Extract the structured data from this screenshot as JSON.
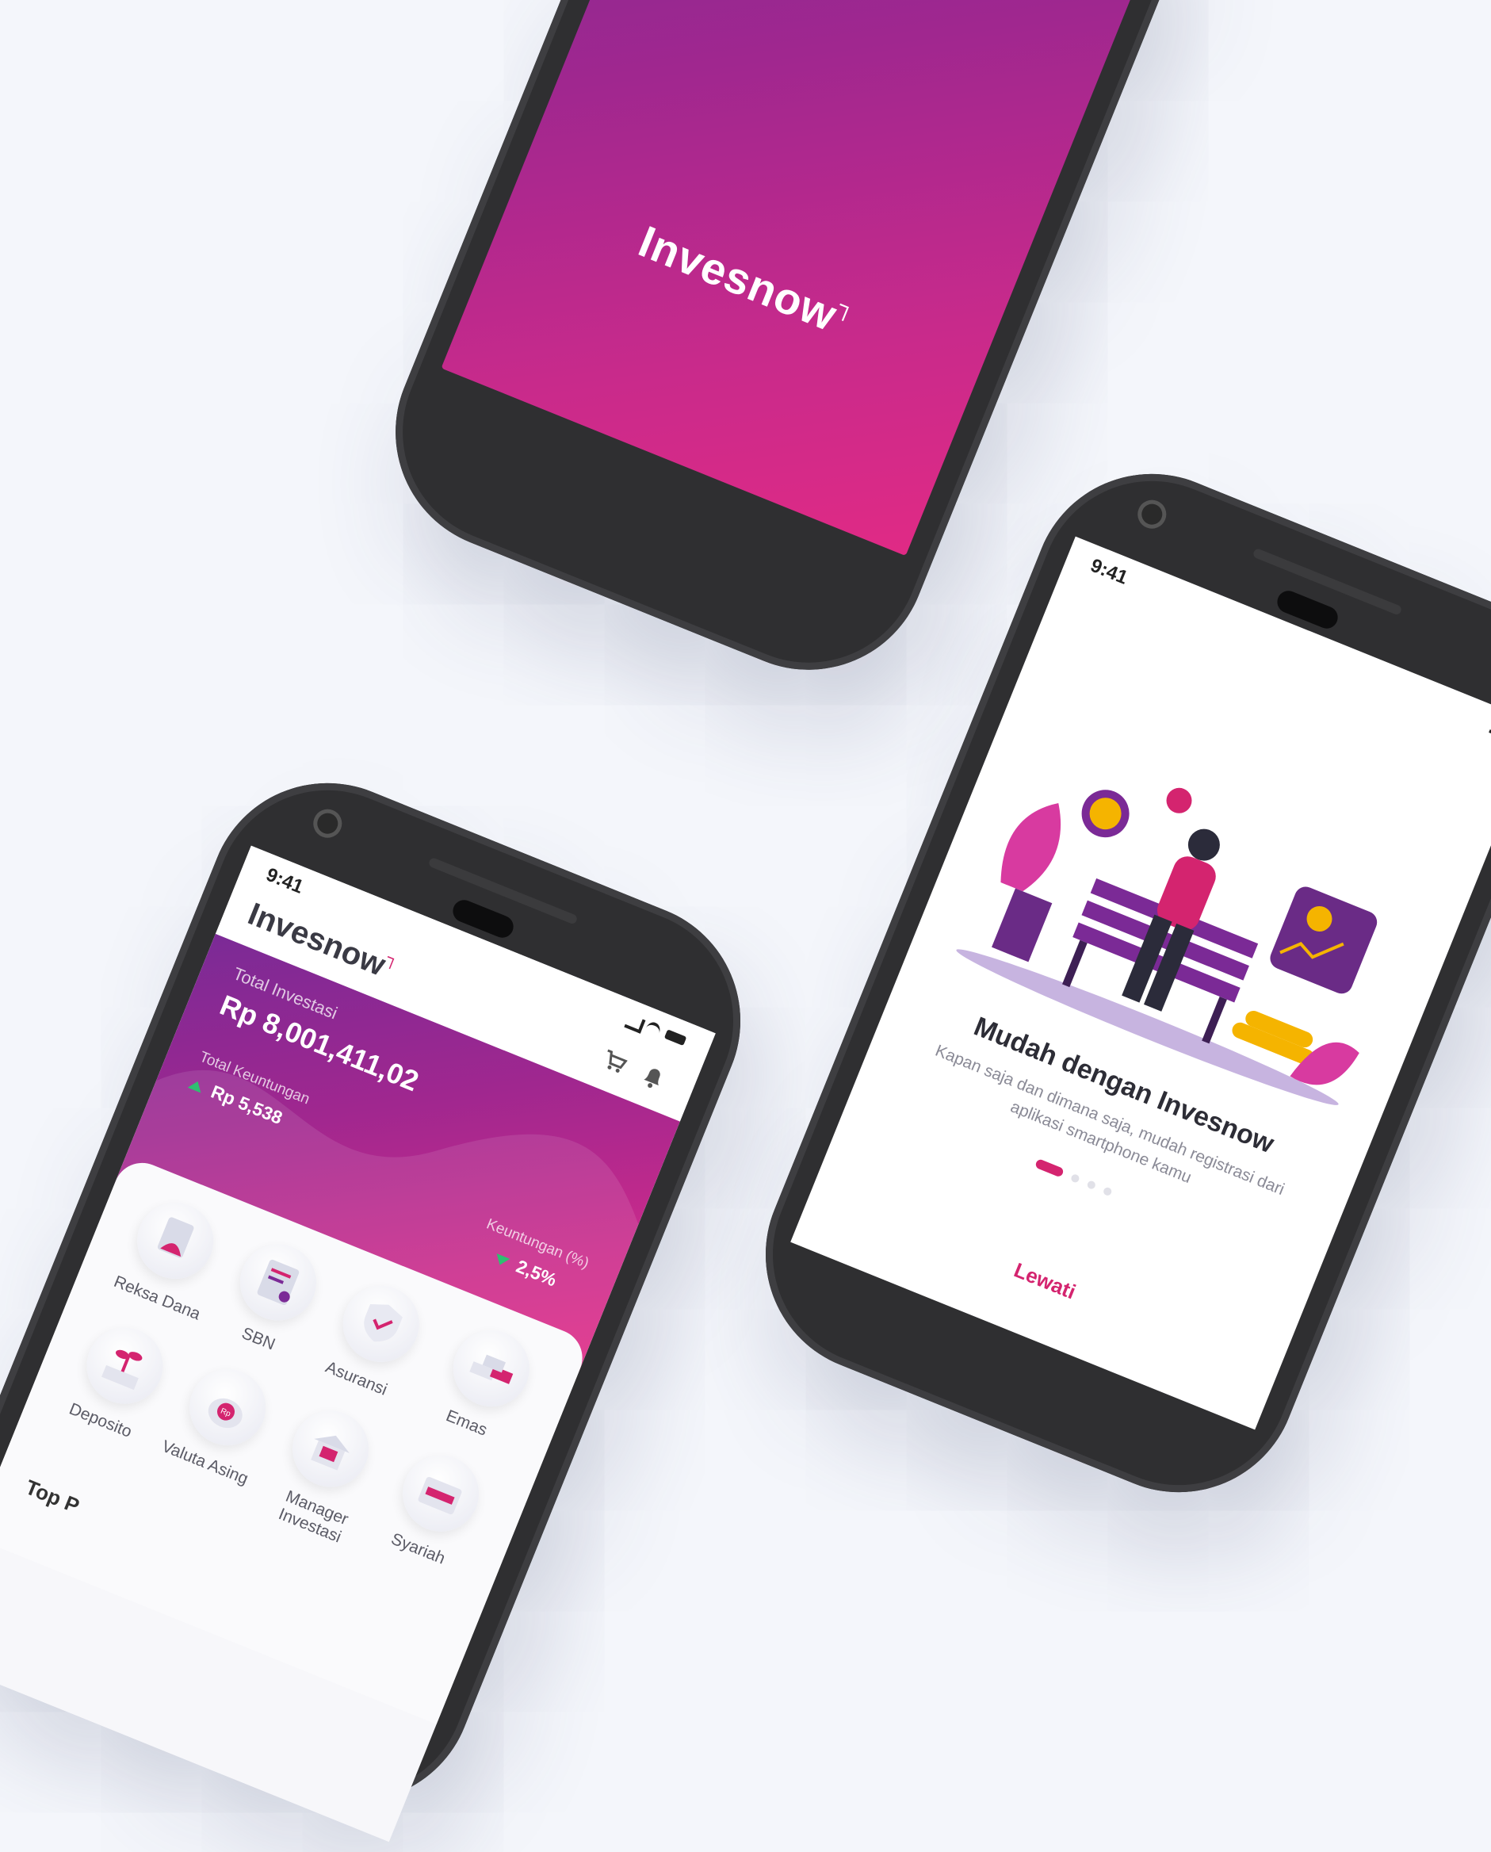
{
  "splash": {
    "logo": "Invesnow"
  },
  "home": {
    "status_time": "9:41",
    "logo": "Invesnow",
    "total_investasi_label": "Total Investasi",
    "total_investasi_value": "Rp 8,001,411,02",
    "total_keuntungan_label": "Total Keuntungan",
    "total_keuntungan_value": "Rp 5,538",
    "keuntungan_pct_label": "Keuntungan (%)",
    "keuntungan_pct_value": "2,5%",
    "menu": [
      {
        "label": "Reksa Dana",
        "icon": "mutual-fund-icon"
      },
      {
        "label": "SBN",
        "icon": "bond-certificate-icon"
      },
      {
        "label": "Asuransi",
        "icon": "insurance-shield-icon"
      },
      {
        "label": "Emas",
        "icon": "gold-bars-icon"
      },
      {
        "label": "Deposito",
        "icon": "deposit-plant-icon"
      },
      {
        "label": "Valuta Asing",
        "icon": "currency-bag-icon"
      },
      {
        "label": "Manager Investasi",
        "icon": "investment-manager-icon"
      },
      {
        "label": "Syariah",
        "icon": "syariah-folder-icon"
      }
    ],
    "section_partial": "Top P"
  },
  "onboarding": {
    "status_time": "9:41",
    "title": "Mudah dengan Invesnow",
    "subtitle": "Kapan saja dan dimana saja, mudah registrasi dari aplikasi smartphone kamu",
    "skip_label": "Lewati",
    "page_indicator": {
      "current": 1,
      "total": 4
    }
  },
  "colors": {
    "brand_purple": "#7b2a96",
    "brand_pink": "#e02a85",
    "accent_text": "#d4246f",
    "gain_green": "#2fbf71"
  }
}
